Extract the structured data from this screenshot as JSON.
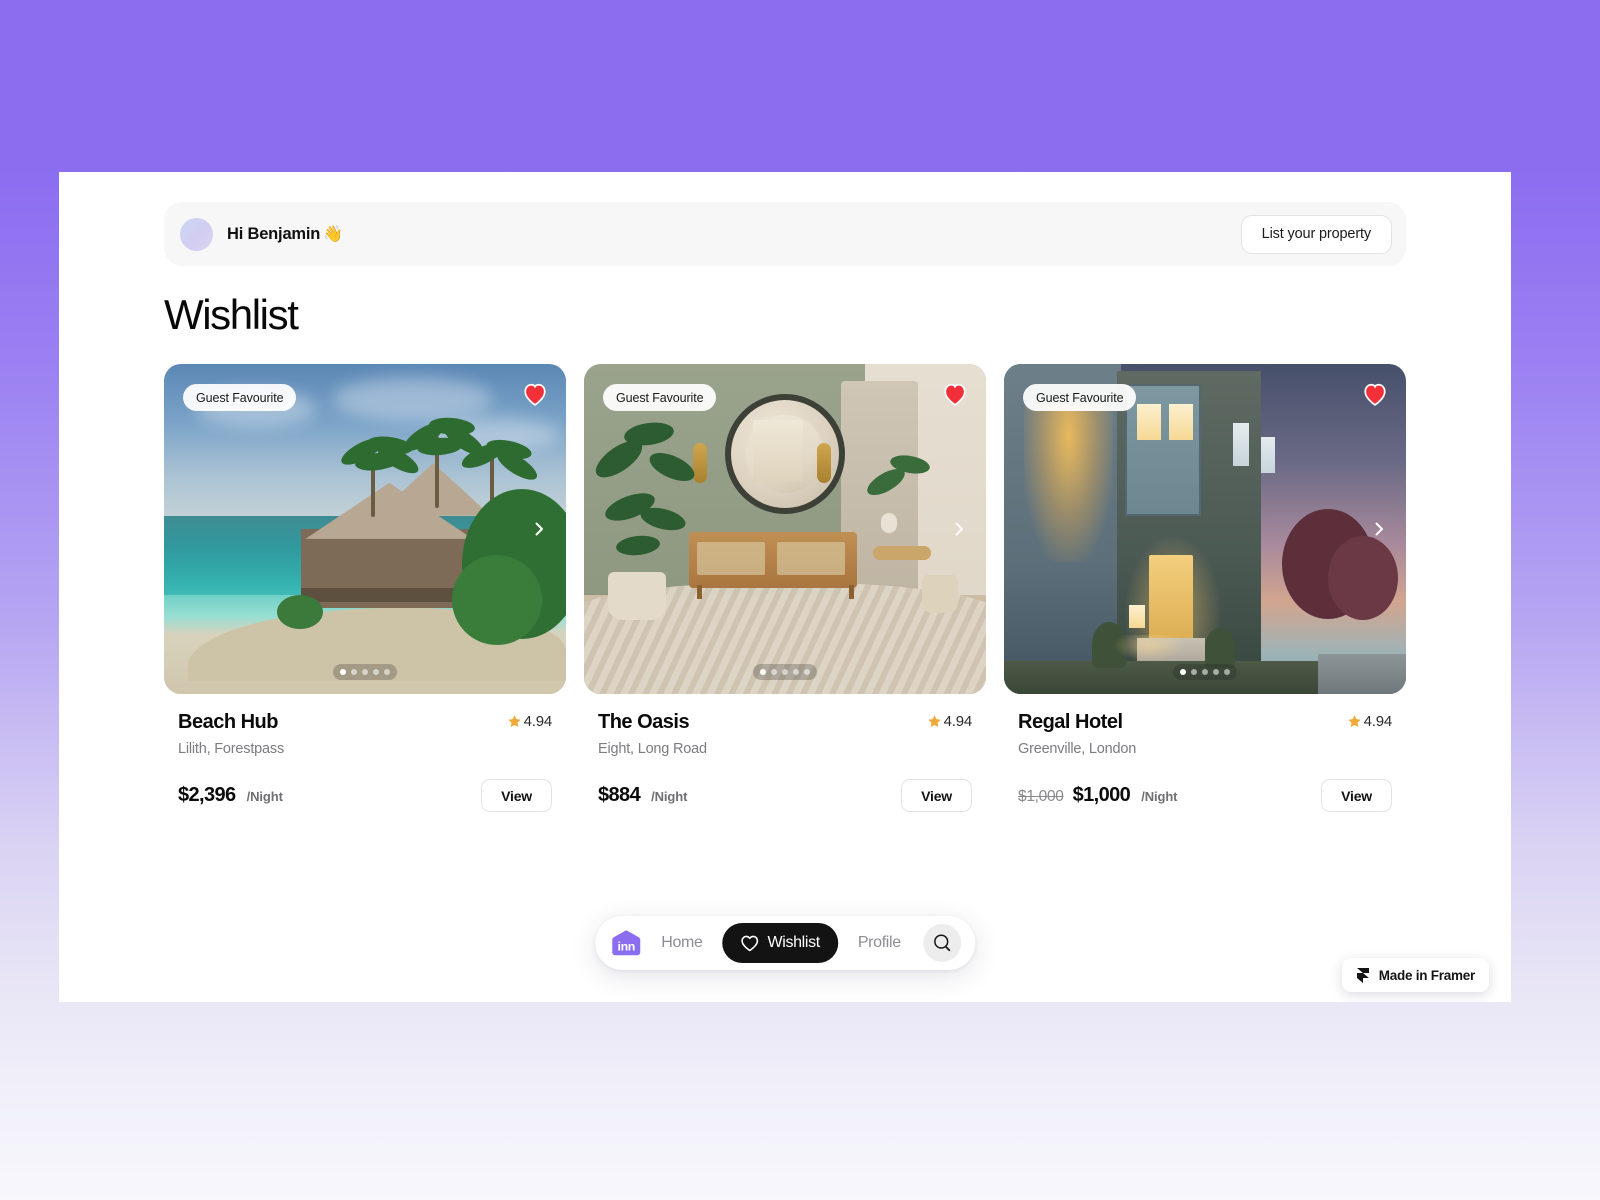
{
  "theme": {
    "background_purple": "#8b6df0",
    "accent_logo_purple": "#8b6df0",
    "pill_dark": "#131313",
    "heart_red": "#f3303a",
    "star_gold": "#f0a93a"
  },
  "header": {
    "greeting": "Hi Benjamin",
    "wave_emoji": "👋",
    "avatar_name": "avatar",
    "list_property_label": "List your property"
  },
  "page": {
    "title": "Wishlist"
  },
  "cards": [
    {
      "badge": "Guest Favourite",
      "title": "Beach Hub",
      "location": "Lilith, Forestpass",
      "rating": "4.94",
      "price_old": "",
      "price": "$2,396",
      "price_unit": "/Night",
      "view_label": "View",
      "dots_total": 5,
      "dots_active": 0,
      "favourited": true
    },
    {
      "badge": "Guest Favourite",
      "title": "The Oasis",
      "location": "Eight, Long Road",
      "rating": "4.94",
      "price_old": "",
      "price": "$884",
      "price_unit": "/Night",
      "view_label": "View",
      "dots_total": 5,
      "dots_active": 0,
      "favourited": true
    },
    {
      "badge": "Guest Favourite",
      "title": "Regal Hotel",
      "location": "Greenville, London",
      "rating": "4.94",
      "price_old": "$1,000",
      "price": "$1,000",
      "price_unit": "/Night",
      "view_label": "View",
      "dots_total": 5,
      "dots_active": 0,
      "favourited": true
    }
  ],
  "bottom_nav": {
    "logo_text": "inn",
    "home_label": "Home",
    "wishlist_label": "Wishlist",
    "profile_label": "Profile",
    "search_icon": "search-icon"
  },
  "framer_badge": {
    "label": "Made in Framer"
  }
}
